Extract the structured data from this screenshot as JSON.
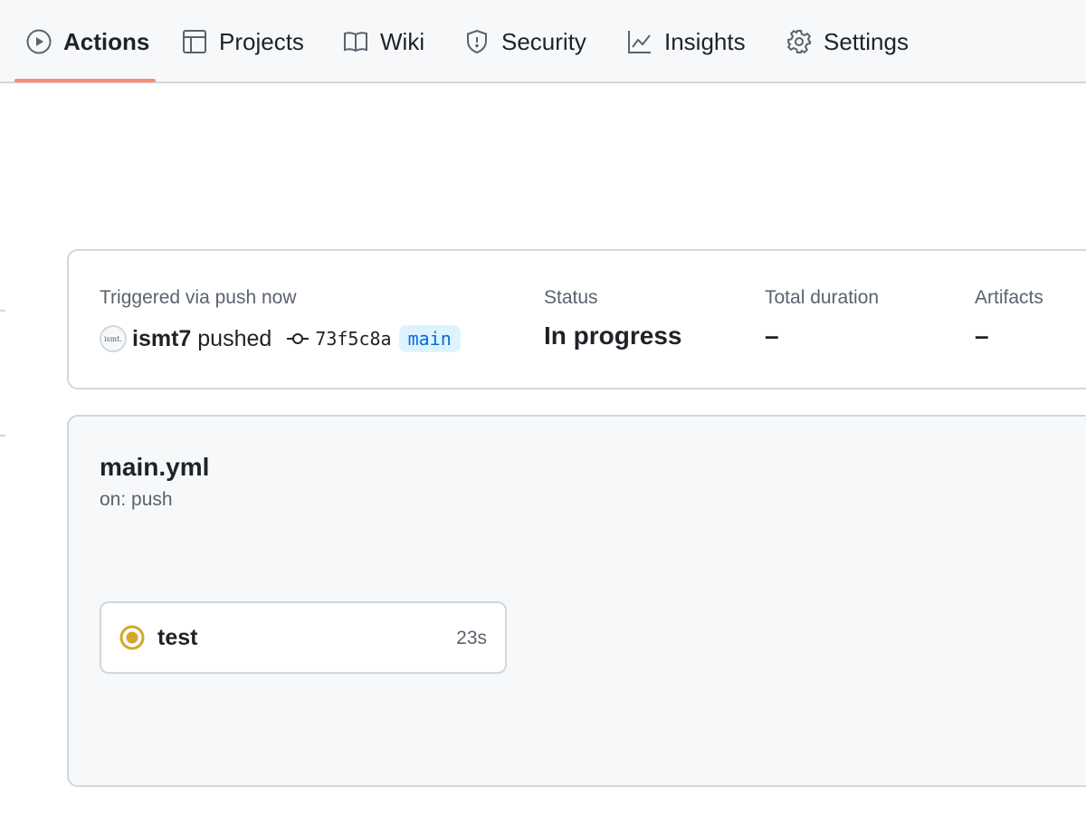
{
  "nav": {
    "items": [
      {
        "label": "Actions",
        "icon": "play-icon",
        "active": true
      },
      {
        "label": "Projects",
        "icon": "table-icon",
        "active": false
      },
      {
        "label": "Wiki",
        "icon": "book-icon",
        "active": false
      },
      {
        "label": "Security",
        "icon": "shield-icon",
        "active": false
      },
      {
        "label": "Insights",
        "icon": "graph-icon",
        "active": false
      },
      {
        "label": "Settings",
        "icon": "gear-icon",
        "active": false
      }
    ],
    "active_underline_color": "#fd8c73"
  },
  "summary": {
    "trigger_label": "Triggered via push now",
    "avatar_text": "ismt.",
    "actor": "ismt7",
    "action": "pushed",
    "commit_sha": "73f5c8a",
    "branch": "main",
    "status_label": "Status",
    "status_value": "In progress",
    "duration_label": "Total duration",
    "duration_value": "–",
    "artifacts_label": "Artifacts",
    "artifacts_value": "–"
  },
  "workflow": {
    "file": "main.yml",
    "trigger": "on: push",
    "jobs": [
      {
        "name": "test",
        "duration": "23s",
        "status": "in-progress",
        "status_color": "#d4a72c"
      }
    ]
  }
}
